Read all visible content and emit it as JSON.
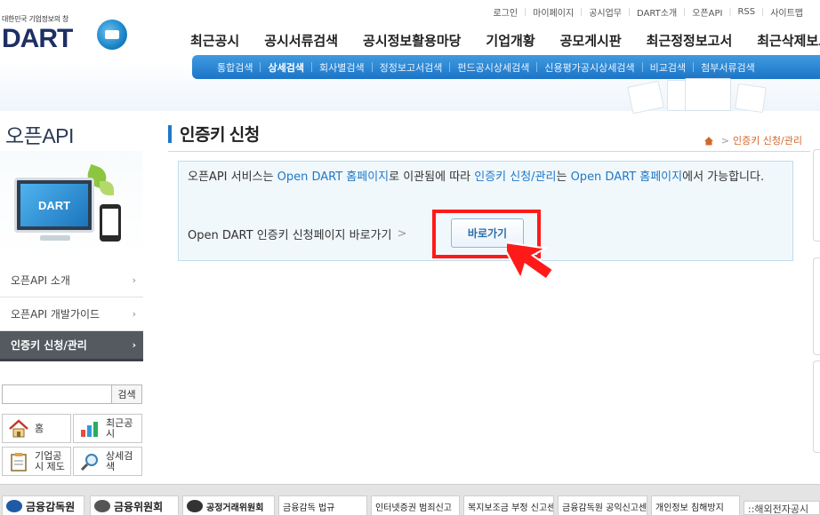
{
  "brand": {
    "tagline": "대한민국 기업정보의 창",
    "logo_text": "DART"
  },
  "util_links": [
    "로그인",
    "마이페이지",
    "공시업무",
    "DART소개",
    "오픈API",
    "RSS",
    "사이트맵"
  ],
  "gnb": [
    "최근공시",
    "공시서류검색",
    "공시정보활용마당",
    "기업개황",
    "공모게시판",
    "최근정정보고서",
    "최근삭제보고서"
  ],
  "subnav": {
    "items": [
      "통합검색",
      "상세검색",
      "회사별검색",
      "정정보고서검색",
      "펀드공시상세검색",
      "신용평가공시상세검색",
      "비교검색",
      "첨부서류검색"
    ],
    "active_index": 1
  },
  "sidebar": {
    "title": "오픈API",
    "visual_text": "DART",
    "menu": [
      {
        "label": "오픈API 소개",
        "arrow": "›"
      },
      {
        "label": "오픈API 개발가이드",
        "arrow": "›"
      },
      {
        "label": "인증키 신청/관리",
        "arrow": "›"
      }
    ],
    "search": {
      "placeholder": "",
      "button": "검색"
    },
    "quick": [
      {
        "label": "홈",
        "icon": "home-icon"
      },
      {
        "label": "최근공시",
        "icon": "chart-icon"
      },
      {
        "label": "기업공시 제도",
        "icon": "clipboard-icon"
      },
      {
        "label": "상세검색",
        "icon": "magnifier-icon"
      }
    ]
  },
  "content": {
    "title": "인증키 신청",
    "breadcrumb": {
      "sep": ">",
      "current": "인증키 신청/관리"
    },
    "notice": {
      "t1": "오픈API 서비스는 ",
      "t2": "Open DART 홈페이지",
      "t3": "로 이관됨에 따라 ",
      "t4": "인증키 신청/관리",
      "t5": "는 ",
      "t6": "Open DART 홈페이지",
      "t7": "에서 가능합니다.",
      "row2": "Open DART 인증키 신청페이지 바로가기",
      "row2_arrow": ">",
      "button": "바로가기"
    },
    "colors": {
      "accent": "#1f78c8",
      "highlight_box": "#ff1a1a",
      "cursor": "#ff1a1a"
    }
  },
  "footer": {
    "links": [
      "금융감독원",
      "금융위원회",
      "공정거래위원회",
      "금융감독 법규",
      "인터넷증권 범죄신고",
      "복지보조금 부정 신고센터",
      "금융감독원 공익신고센터",
      "개인정보 침해방지"
    ],
    "overseas": "::해외전자공시"
  }
}
